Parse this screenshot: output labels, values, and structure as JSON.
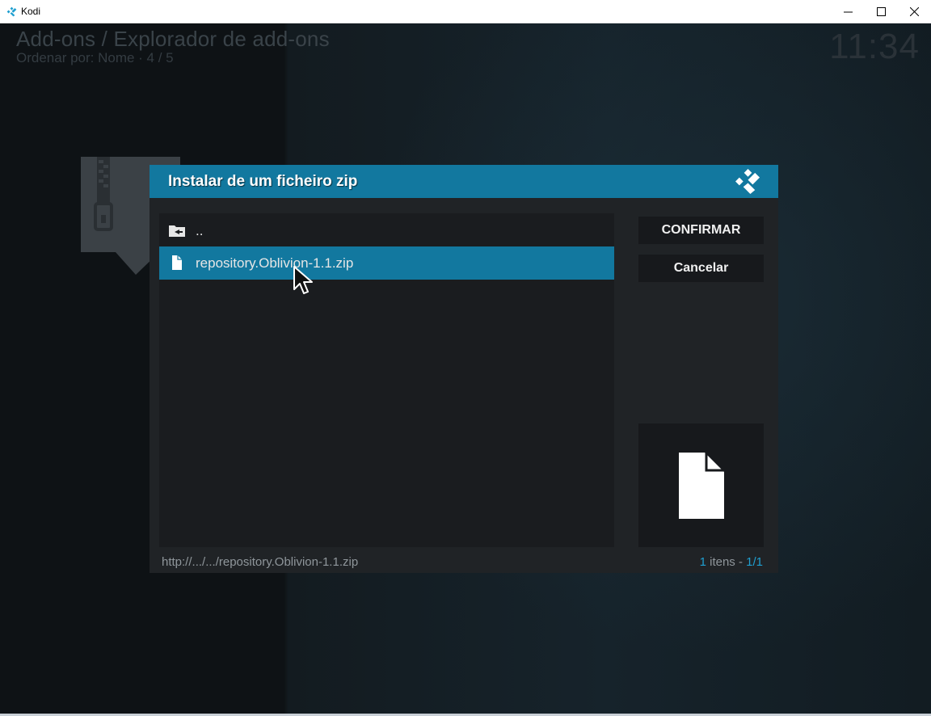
{
  "window": {
    "title": "Kodi",
    "controls": [
      "minimize-icon",
      "maximize-icon",
      "close-icon"
    ]
  },
  "header": {
    "title": "Add-ons / Explorador de add-ons",
    "subtitle": "Ordenar por: Nome · 4 / 5",
    "clock": "11:34"
  },
  "dialog": {
    "title": "Instalar de um ficheiro zip",
    "logo_icon": "kodi-logo-icon",
    "items": [
      {
        "label": "..",
        "icon": "folder-back-icon",
        "selected": false
      },
      {
        "label": "repository.Oblivion-1.1.zip",
        "icon": "file-icon",
        "selected": true
      }
    ],
    "buttons": {
      "confirm": "CONFIRMAR",
      "cancel": "Cancelar"
    },
    "preview_icon": "file-icon",
    "footer": {
      "path": "http://.../.../repository.Oblivion-1.1.zip",
      "count_number": "1",
      "count_text": " itens - ",
      "page": "1/1"
    }
  },
  "colors": {
    "accent": "#12789f",
    "dialog_bg": "#202326",
    "list_bg": "#1a1c1f",
    "button_bg": "#17191c",
    "count_accent": "#1f9fd0"
  }
}
